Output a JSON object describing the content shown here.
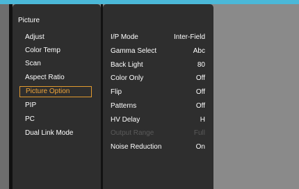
{
  "menu": {
    "title": "Picture",
    "items": [
      {
        "label": "Adjust",
        "selected": false
      },
      {
        "label": "Color Temp",
        "selected": false
      },
      {
        "label": "Scan",
        "selected": false
      },
      {
        "label": "Aspect Ratio",
        "selected": false
      },
      {
        "label": "Picture Option",
        "selected": true
      },
      {
        "label": "PIP",
        "selected": false
      },
      {
        "label": "PC",
        "selected": false
      },
      {
        "label": "Dual Link Mode",
        "selected": false
      }
    ]
  },
  "settings": [
    {
      "label": "I/P Mode",
      "value": "Inter-Field",
      "disabled": false
    },
    {
      "label": "Gamma Select",
      "value": "Abc",
      "disabled": false
    },
    {
      "label": "Back Light",
      "value": "80",
      "disabled": false
    },
    {
      "label": "Color Only",
      "value": "Off",
      "disabled": false
    },
    {
      "label": "Flip",
      "value": "Off",
      "disabled": false
    },
    {
      "label": "Patterns",
      "value": "Off",
      "disabled": false
    },
    {
      "label": "HV Delay",
      "value": "H",
      "disabled": false
    },
    {
      "label": "Output Range",
      "value": "Full",
      "disabled": true
    },
    {
      "label": "Noise Reduction",
      "value": "On",
      "disabled": false
    }
  ],
  "colors": {
    "accent": "#e29a2f",
    "panel": "#2e2e2e",
    "background": "#8a8a8a",
    "top_strip": "#4bb8d8"
  }
}
